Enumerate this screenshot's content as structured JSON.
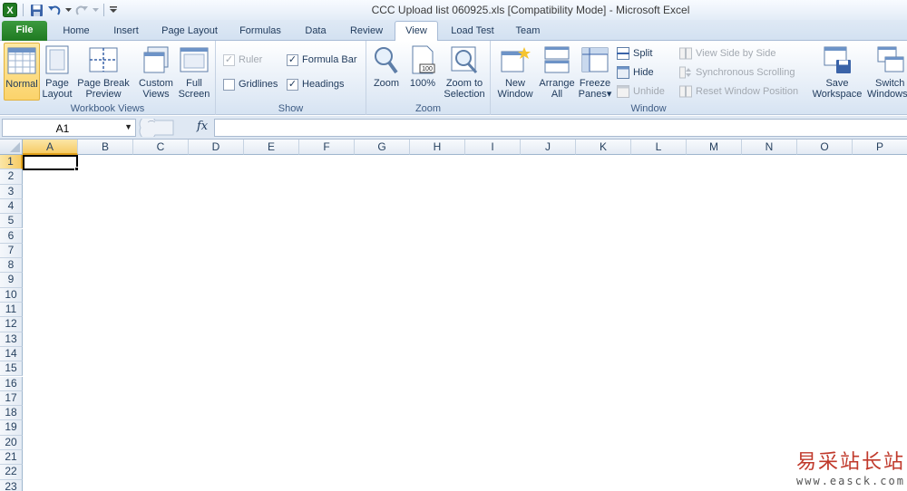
{
  "window": {
    "title": "CCC Upload list 060925.xls  [Compatibility Mode]  -  Microsoft Excel"
  },
  "qat": {
    "icons": [
      "excel-app-icon",
      "save-icon",
      "undo-icon",
      "redo-icon",
      "customize-qat-icon"
    ]
  },
  "tabs": [
    {
      "label": "File"
    },
    {
      "label": "Home"
    },
    {
      "label": "Insert"
    },
    {
      "label": "Page Layout"
    },
    {
      "label": "Formulas"
    },
    {
      "label": "Data"
    },
    {
      "label": "Review"
    },
    {
      "label": "View"
    },
    {
      "label": "Load Test"
    },
    {
      "label": "Team"
    }
  ],
  "active_tab": "View",
  "ribbon": {
    "workbook_views": {
      "label": "Workbook Views",
      "normal": "Normal",
      "page_layout_1": "Page",
      "page_layout_2": "Layout",
      "page_break_1": "Page Break",
      "page_break_2": "Preview",
      "custom_views_1": "Custom",
      "custom_views_2": "Views",
      "full_screen_1": "Full",
      "full_screen_2": "Screen"
    },
    "show": {
      "label": "Show",
      "ruler": "Ruler",
      "gridlines": "Gridlines",
      "formula_bar": "Formula Bar",
      "headings": "Headings"
    },
    "zoom": {
      "label": "Zoom",
      "zoom": "Zoom",
      "hundred": "100%",
      "to_sel_1": "Zoom to",
      "to_sel_2": "Selection"
    },
    "window": {
      "label": "Window",
      "new_window_1": "New",
      "new_window_2": "Window",
      "arrange_1": "Arrange",
      "arrange_2": "All",
      "freeze_1": "Freeze",
      "freeze_2": "Panes",
      "split": "Split",
      "hide": "Hide",
      "unhide": "Unhide",
      "side_by_side": "View Side by Side",
      "sync_scroll": "Synchronous Scrolling",
      "reset_pos": "Reset Window Position",
      "save_ws_1": "Save",
      "save_ws_2": "Workspace",
      "switch_1": "Switch",
      "switch_2": "Windows"
    }
  },
  "formula_bar": {
    "name_box": "A1",
    "fx_label": "fx",
    "formula": ""
  },
  "grid": {
    "columns": [
      "A",
      "B",
      "C",
      "D",
      "E",
      "F",
      "G",
      "H",
      "I",
      "J",
      "K",
      "L",
      "M",
      "N",
      "O",
      "P"
    ],
    "rows": [
      "1",
      "2",
      "3",
      "4",
      "5",
      "6",
      "7",
      "8",
      "9",
      "10",
      "11",
      "12",
      "13",
      "14",
      "15",
      "16",
      "17",
      "18",
      "19",
      "20",
      "21",
      "22",
      "23"
    ],
    "selected_cell": "A1"
  },
  "watermark": {
    "cn": "易采站长站",
    "url": "www.easck.com"
  }
}
